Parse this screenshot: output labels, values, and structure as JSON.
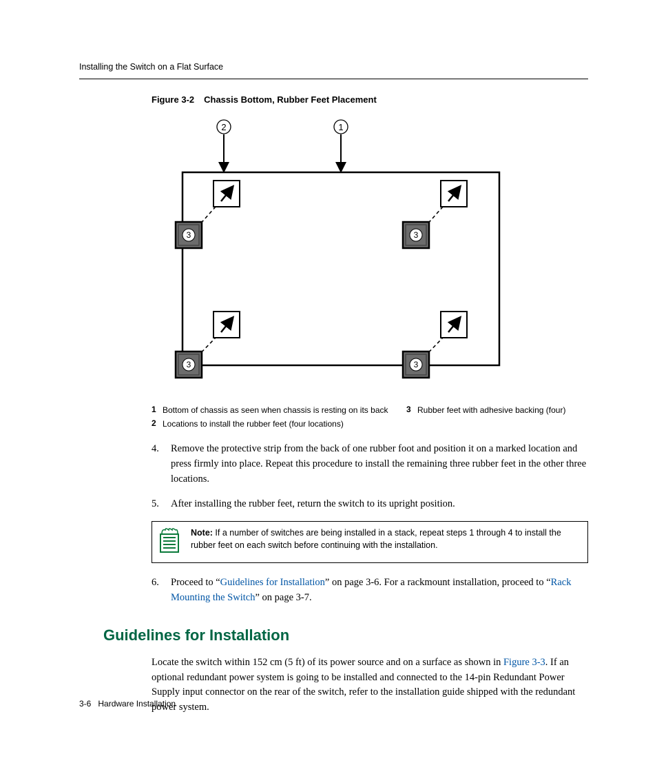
{
  "header": {
    "section": "Installing the Switch on a Flat Surface"
  },
  "figure": {
    "label": "Figure 3-2",
    "title": "Chassis Bottom, Rubber Feet Placement",
    "callouts": {
      "c1": "1",
      "c2": "2",
      "c3": "3"
    },
    "legend": [
      {
        "num": "1",
        "text": "Bottom of chassis as seen when chassis is resting on its back"
      },
      {
        "num": "2",
        "text": "Locations to install the rubber feet (four locations)"
      },
      {
        "num": "3",
        "text": "Rubber feet with adhesive backing (four)"
      }
    ]
  },
  "steps": {
    "s4": {
      "num": "4.",
      "text": "Remove the protective strip from the back of one rubber foot and position it on a marked location and press firmly into place. Repeat this procedure to install the remaining three rubber feet in the other three locations."
    },
    "s5": {
      "num": "5.",
      "text": "After installing the rubber feet, return the switch to its upright position."
    },
    "s6": {
      "num": "6.",
      "pre": "Proceed to “",
      "link1": "Guidelines for Installation",
      "mid": "” on page 3-6. For a rackmount installation, proceed to “",
      "link2": "Rack Mounting the Switch",
      "post": "” on page 3-7."
    }
  },
  "note": {
    "label": "Note:",
    "text": " If a number of switches are being installed in a stack, repeat steps 1 through 4 to install the rubber feet on each switch before continuing with the installation."
  },
  "guidelines": {
    "heading": "Guidelines for Installation",
    "para": {
      "pre": "Locate the switch within 152 cm (5 ft) of its power source and on a surface as shown in ",
      "ref": "Figure 3-3",
      "post": ". If an optional redundant power system is going to be installed and connected to the 14-pin Redundant Power Supply input connector on the rear of the switch, refer to the installation guide shipped with the redundant power system."
    }
  },
  "footer": {
    "page": "3-6",
    "title": "Hardware Installation"
  }
}
